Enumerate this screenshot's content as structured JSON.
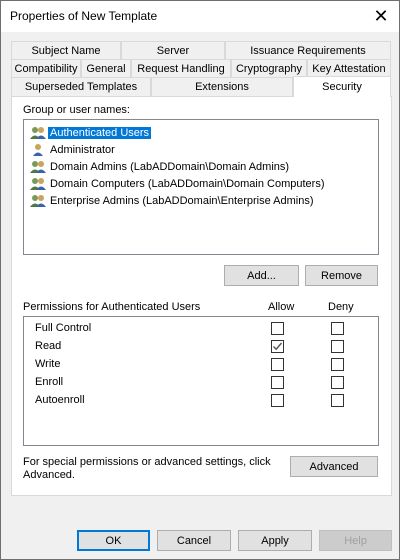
{
  "window": {
    "title": "Properties of New Template",
    "close_glyph": "✕"
  },
  "tabs": {
    "row1": [
      "Subject Name",
      "Server",
      "Issuance Requirements"
    ],
    "row2": [
      "Compatibility",
      "General",
      "Request Handling",
      "Cryptography",
      "Key Attestation"
    ],
    "row3": [
      "Superseded Templates",
      "Extensions",
      "Security"
    ],
    "active": "Security"
  },
  "security": {
    "group_label": "Group or user names:",
    "users": [
      {
        "name": "Authenticated Users",
        "icon": "group-icon",
        "selected": true
      },
      {
        "name": "Administrator",
        "icon": "user-icon",
        "selected": false
      },
      {
        "name": "Domain Admins (LabADDomain\\Domain Admins)",
        "icon": "group-icon",
        "selected": false
      },
      {
        "name": "Domain Computers (LabADDomain\\Domain Computers)",
        "icon": "group-icon",
        "selected": false
      },
      {
        "name": "Enterprise Admins (LabADDomain\\Enterprise Admins)",
        "icon": "group-icon",
        "selected": false
      }
    ],
    "add_label": "Add...",
    "remove_label": "Remove",
    "permissions_label": "Permissions for Authenticated Users",
    "allow_header": "Allow",
    "deny_header": "Deny",
    "permissions": [
      {
        "name": "Full Control",
        "allow": false,
        "deny": false
      },
      {
        "name": "Read",
        "allow": true,
        "deny": false
      },
      {
        "name": "Write",
        "allow": false,
        "deny": false
      },
      {
        "name": "Enroll",
        "allow": false,
        "deny": false
      },
      {
        "name": "Autoenroll",
        "allow": false,
        "deny": false
      }
    ],
    "special_note": "For special permissions or advanced settings, click Advanced.",
    "advanced_label": "Advanced"
  },
  "footer": {
    "ok_label": "OK",
    "cancel_label": "Cancel",
    "apply_label": "Apply",
    "help_label": "Help"
  },
  "colors": {
    "selection": "#0078d7",
    "check": "#555555"
  }
}
